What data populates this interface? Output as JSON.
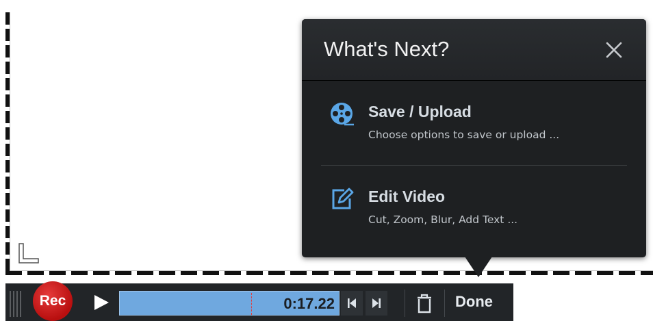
{
  "popup": {
    "title": "What's Next?",
    "close_icon": "close-icon",
    "options": [
      {
        "icon": "film-reel-icon",
        "title": "Save / Upload",
        "description": "Choose options to save or upload ..."
      },
      {
        "icon": "edit-icon",
        "title": "Edit Video",
        "description": "Cut, Zoom, Blur, Add Text ..."
      }
    ]
  },
  "toolbar": {
    "rec_label": "Rec",
    "time": "0:17.22",
    "done_label": "Done",
    "playhead_fraction": 0.6
  },
  "colors": {
    "popup_bg": "#1e2022",
    "accent_blue": "#5aa6e6",
    "timeline_fill": "#6fa8df",
    "rec_red": "#c41a1a"
  }
}
